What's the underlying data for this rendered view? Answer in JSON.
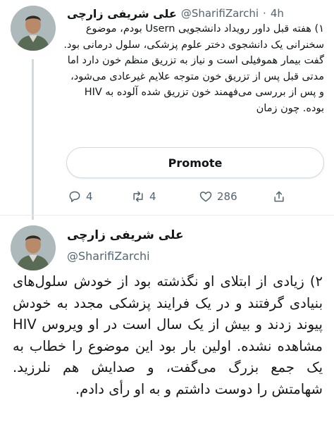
{
  "tweet1": {
    "author_name": "علی شریفی زارچی",
    "handle": "@SharifiZarchi",
    "separator": "·",
    "time": "4h",
    "text": "۱) هفته قبل داور رویداد دانشجویی Usern بودم، موضوع سخنرانی یک دانشجوی دختر علوم پزشکی، سلول درمانی بود. گفت بیمار هموفیلی است و نیاز به تزریق منظم خون دارد اما مدتی قبل پس از تزریق خون متوجه علایم غیرعادی می‌شود، و پس از بررسی می‌فهمند خون تزریق شده آلوده به HIV بوده. چون زمان",
    "promote_label": "Promote",
    "reply_count": "4",
    "retweet_count": "4",
    "like_count": "286"
  },
  "tweet2": {
    "author_name": "علی شریفی زارچی",
    "handle": "@SharifiZarchi",
    "text": "۲) زیادی از ابتلای او نگذشته بود از خودش سلول‌های بنیادی گرفتند و در یک فرایند پزشکی مجدد به خودش پیوند زدند و بیش از یک سال است در او ویروس HIV مشاهده نشده. اولین بار بود این موضوع را خطاب به یک جمع بزرگ می‌گفت، و صدایش هم نلرزید. شهامتش را دوست داشتم و به او رأی دادم."
  },
  "icons": [
    "avatar",
    "reply-icon",
    "retweet-icon",
    "like-icon",
    "share-icon"
  ],
  "colors": {
    "text": "#14171a",
    "muted": "#536471",
    "border": "#cfd9de"
  }
}
